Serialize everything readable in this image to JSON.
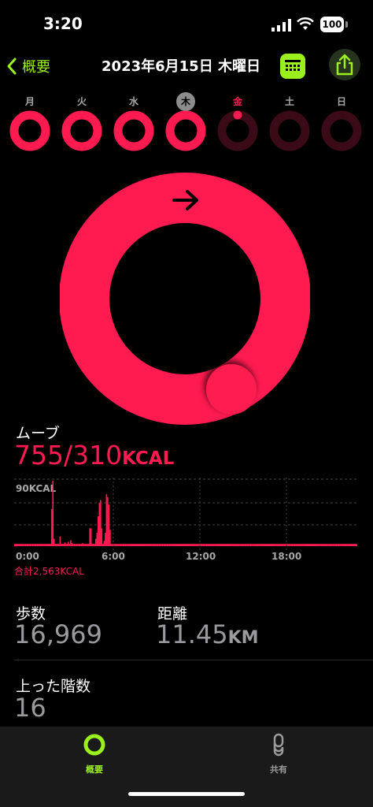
{
  "status": {
    "time": "3:20",
    "battery": "100"
  },
  "nav": {
    "back_label": "概要",
    "title": "2023年6月15日 木曜日"
  },
  "week": {
    "days": [
      "月",
      "火",
      "水",
      "木",
      "金",
      "土",
      "日"
    ],
    "selected_index": 3,
    "today_index": 4,
    "ring_progress": [
      1.0,
      1.0,
      1.0,
      1.0,
      0.02,
      0,
      0
    ]
  },
  "move": {
    "label": "ムーブ",
    "value": "755/310",
    "unit": "KCAL",
    "progress_percent": 243,
    "color": "#ff1a50"
  },
  "chart_data": {
    "type": "bar",
    "ylabel": "90KCAL",
    "ylim": [
      0,
      90
    ],
    "x_ticks": [
      "0:00",
      "6:00",
      "12:00",
      "18:00"
    ],
    "total_label": "合計2,563KCAL",
    "bins_per_hour": 4,
    "values": [
      3,
      3,
      3,
      3,
      3,
      3,
      3,
      3,
      3,
      3,
      3,
      3,
      3,
      3,
      3,
      3,
      3,
      3,
      3,
      3,
      3,
      3,
      3,
      3,
      3,
      3,
      3,
      3,
      3,
      3,
      3,
      3,
      3,
      3,
      3,
      3,
      3,
      3,
      3,
      3,
      3,
      3,
      3,
      3,
      3,
      3,
      3,
      3,
      3,
      3,
      3,
      3,
      3,
      3,
      3,
      3,
      3,
      3,
      3,
      3,
      3,
      3,
      3,
      3,
      3,
      3,
      3,
      3,
      3,
      3,
      3,
      3,
      3,
      3,
      3,
      3,
      3,
      3,
      3,
      3,
      3,
      3,
      3,
      3,
      3,
      3,
      3,
      3,
      3,
      3,
      3,
      3,
      3,
      3,
      3,
      3,
      3,
      3,
      3,
      3,
      3,
      3,
      3,
      3,
      3,
      3,
      3,
      3,
      3,
      3,
      3,
      3,
      3,
      3,
      3,
      3,
      3,
      3,
      3,
      3,
      3,
      3,
      3,
      3,
      3,
      3,
      3,
      3,
      3,
      3,
      3,
      3,
      3,
      3,
      3,
      3,
      3,
      3,
      3,
      3,
      3,
      3,
      3,
      3,
      3,
      3,
      3,
      3,
      3,
      3,
      3,
      3,
      3,
      3,
      3,
      3,
      3,
      3,
      3,
      3,
      3,
      3,
      3,
      3,
      3,
      3,
      3,
      3,
      3,
      3,
      3,
      3,
      3,
      3,
      3,
      3,
      3,
      3,
      3,
      3,
      3,
      3,
      3,
      3,
      3,
      3,
      3,
      3,
      3,
      3,
      3,
      3,
      3,
      3,
      3,
      3,
      3,
      3,
      3,
      3,
      3,
      3,
      3,
      3,
      3,
      3,
      3,
      3,
      3,
      3,
      3,
      3,
      3,
      3,
      3,
      3,
      3,
      3,
      3,
      3,
      3,
      3,
      3,
      3,
      3,
      3,
      3,
      3,
      3,
      3,
      3,
      3,
      3,
      3,
      3,
      3,
      3,
      3,
      3,
      3,
      3,
      3,
      3,
      3,
      3,
      3,
      3,
      3,
      3,
      3,
      3,
      3,
      3,
      3,
      3,
      3,
      3,
      3,
      3,
      3,
      3,
      3,
      3,
      3,
      3,
      3,
      3,
      3,
      3,
      3,
      3,
      3,
      3,
      3,
      3,
      3,
      3,
      3,
      3,
      3,
      3,
      3,
      3,
      3,
      3,
      3,
      3,
      3
    ]
  },
  "steps": {
    "label": "歩数",
    "value": "16,969"
  },
  "distance": {
    "label": "距離",
    "value": "11.45",
    "unit": "KM"
  },
  "flights": {
    "label": "上った階数",
    "value": "16"
  },
  "tabs": {
    "summary": "概要",
    "sharing": "共有"
  },
  "colors": {
    "accent": "#9BEF1C",
    "move": "#ff1a50",
    "ring_dim": "#3a0a16"
  }
}
